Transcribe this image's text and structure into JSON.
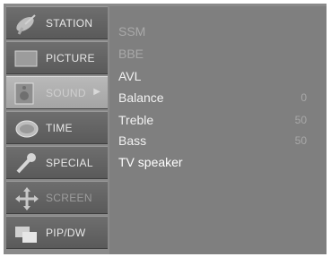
{
  "sidebar": {
    "tabs": [
      {
        "label": "STATION",
        "icon": "satellite-dish-icon"
      },
      {
        "label": "PICTURE",
        "icon": "picture-icon"
      },
      {
        "label": "SOUND",
        "icon": "speaker-icon",
        "arrow": "▶"
      },
      {
        "label": "TIME",
        "icon": "clock-icon"
      },
      {
        "label": "SPECIAL",
        "icon": "wrench-icon"
      },
      {
        "label": "SCREEN",
        "icon": "move-arrows-icon"
      },
      {
        "label": "PIP/DW",
        "icon": "pip-icon"
      }
    ]
  },
  "sound_menu": {
    "items": [
      {
        "name": "SSM",
        "value": ""
      },
      {
        "name": "BBE",
        "value": ""
      },
      {
        "name": "AVL",
        "value": ""
      },
      {
        "name": "Balance",
        "value": "0"
      },
      {
        "name": "Treble",
        "value": "50"
      },
      {
        "name": "Bass",
        "value": "50"
      },
      {
        "name": "TV speaker",
        "value": ""
      }
    ]
  }
}
